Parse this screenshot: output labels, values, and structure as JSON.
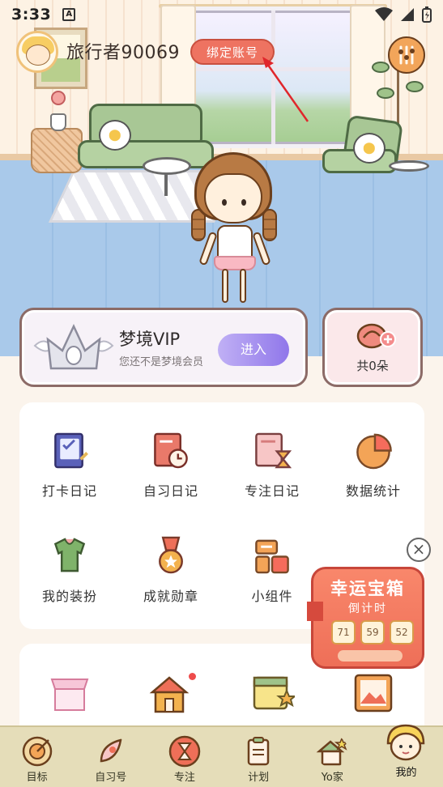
{
  "status_bar": {
    "time": "3:33",
    "a_label": "A"
  },
  "profile": {
    "username": "旅行者90069",
    "bind_label": "绑定账号"
  },
  "vip": {
    "title": "梦境VIP",
    "subtitle": "您还不是梦境会员",
    "enter_label": "进入"
  },
  "flowers": {
    "count_label": "共0朵"
  },
  "grid_row1": [
    {
      "label": "打卡日记",
      "icon": "checklist-book-icon"
    },
    {
      "label": "自习日记",
      "icon": "clock-book-icon"
    },
    {
      "label": "专注日记",
      "icon": "hourglass-book-icon"
    },
    {
      "label": "数据统计",
      "icon": "pie-chart-icon"
    }
  ],
  "grid_row2": [
    {
      "label": "我的装扮",
      "icon": "outfit-icon"
    },
    {
      "label": "成就勋章",
      "icon": "medal-icon"
    },
    {
      "label": "小组件",
      "icon": "widget-icon"
    }
  ],
  "lucky_box": {
    "title": "幸运宝箱",
    "subtitle": "倒计时",
    "countdown": [
      "71",
      "59",
      "52"
    ]
  },
  "bottom_nav": [
    {
      "label": "目标",
      "icon": "target-icon"
    },
    {
      "label": "自习号",
      "icon": "rocket-icon"
    },
    {
      "label": "专注",
      "icon": "hourglass-icon"
    },
    {
      "label": "计划",
      "icon": "clipboard-icon"
    },
    {
      "label": "Yo家",
      "icon": "house-icon"
    },
    {
      "label": "我的",
      "icon": "profile-avatar-icon"
    }
  ],
  "colors": {
    "bind_button": "#ee7361",
    "vip_button": "#9077ea",
    "lucky_box": "#ee6f58",
    "nav_bg": "#e5ddb9"
  }
}
